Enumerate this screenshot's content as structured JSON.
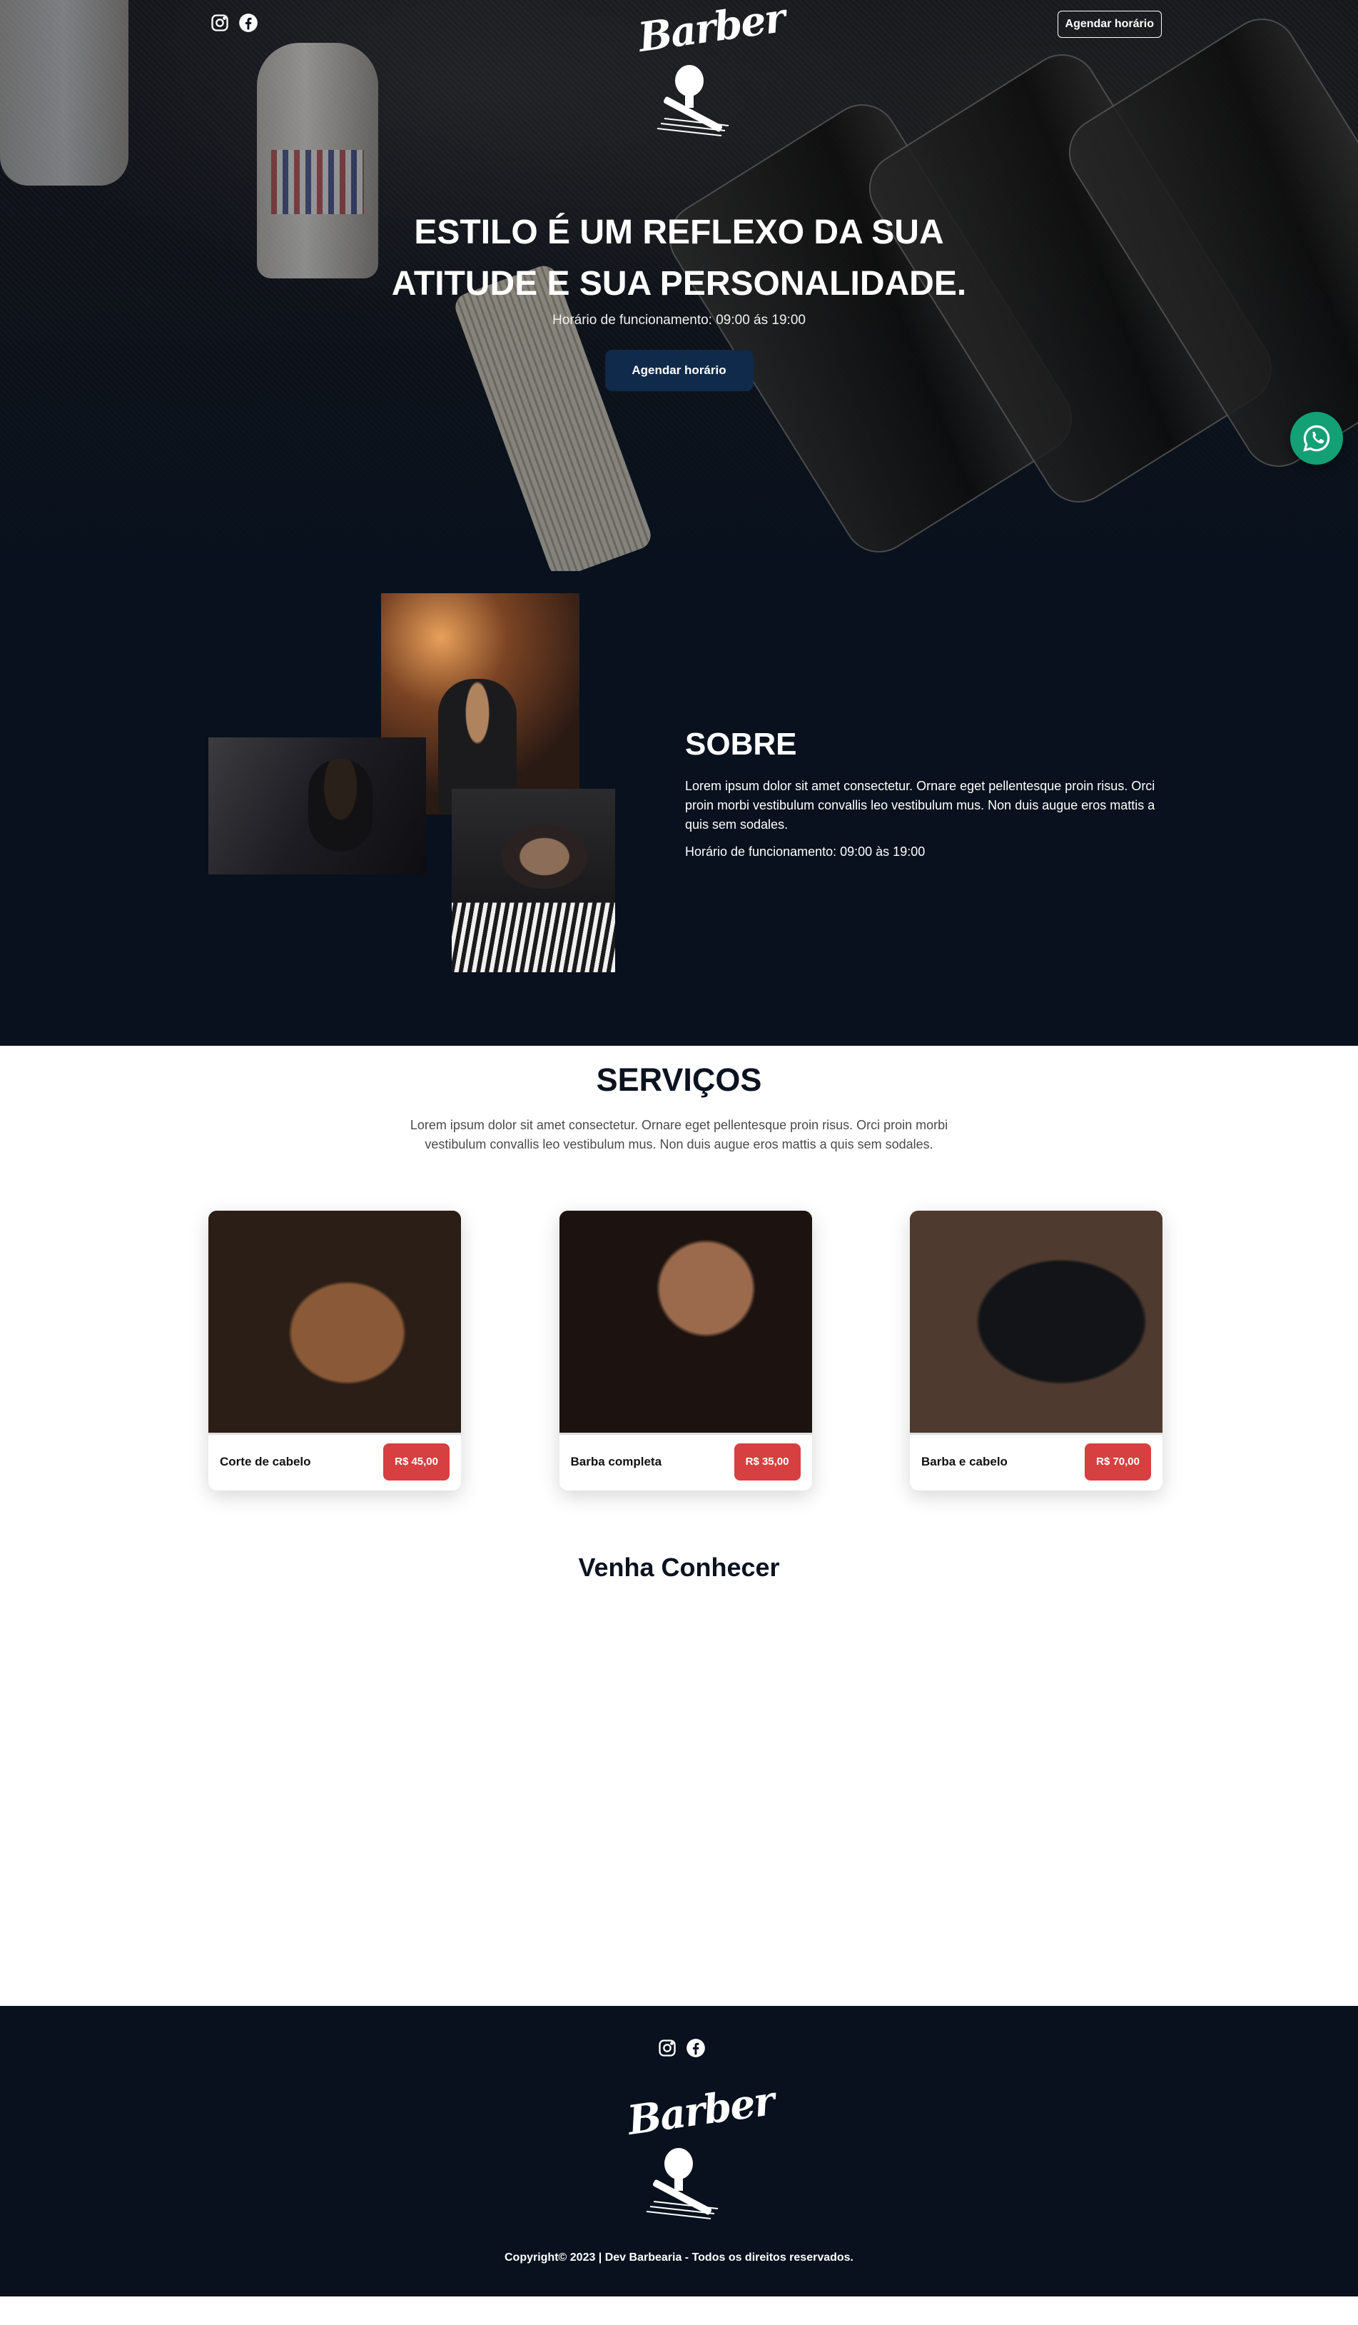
{
  "brand": {
    "logo_text": "Barber"
  },
  "header": {
    "social": [
      {
        "name": "instagram-icon"
      },
      {
        "name": "facebook-icon"
      }
    ],
    "cta_label": "Agendar horário"
  },
  "hero": {
    "title": "ESTILO É UM REFLEXO DA SUA ATITUDE E SUA PERSONALIDADE.",
    "hours": "Horário de funcionamento: 09:00 ás 19:00",
    "cta_label": "Agendar horário"
  },
  "about": {
    "title": "SOBRE",
    "description": "Lorem ipsum dolor sit amet consectetur. Ornare eget pellentesque proin risus. Orci proin morbi vestibulum convallis leo vestibulum mus. Non duis augue eros mattis a quis sem sodales.",
    "hours": "Horário de funcionamento: 09:00 às 19:00"
  },
  "services": {
    "title": "SERVIÇOS",
    "description": "Lorem ipsum dolor sit amet consectetur. Ornare eget pellentesque proin risus. Orci proin morbi vestibulum convallis leo vestibulum mus. Non duis augue eros mattis a quis sem sodales.",
    "items": [
      {
        "name": "Corte de cabelo",
        "price": "R$ 45,00"
      },
      {
        "name": "Barba completa",
        "price": "R$ 35,00"
      },
      {
        "name": "Barba e cabelo",
        "price": "R$ 70,00"
      }
    ]
  },
  "visit": {
    "title": "Venha Conhecer"
  },
  "footer": {
    "copyright": "Copyright© 2023 | Dev Barbearia - Todos os direitos reservados."
  },
  "colors": {
    "navy": "#08111d",
    "button_navy": "#0f2a4a",
    "price_red": "#d64040",
    "whatsapp_green": "#13a074"
  }
}
